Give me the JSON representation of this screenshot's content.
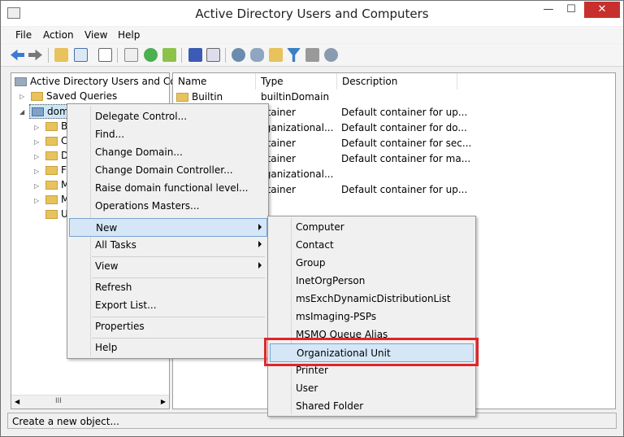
{
  "window": {
    "title": "Active Directory Users and Computers",
    "minimize": "—",
    "maximize": "☐",
    "close": "✕"
  },
  "menubar": [
    "File",
    "Action",
    "View",
    "Help"
  ],
  "toolbar": [
    "back-icon",
    "forward-icon",
    "up-folder-icon",
    "show-tree-icon",
    "properties-icon",
    "copy-icon",
    "refresh-icon",
    "export-icon",
    "help-icon",
    "console-icon",
    "new-user-icon",
    "new-group-icon",
    "new-ou-icon",
    "filter-icon",
    "delegate-icon"
  ],
  "tree": {
    "root": "Active Directory Users and Com",
    "saved_queries": "Saved Queries",
    "domain": "dom",
    "children": [
      "B",
      "C",
      "D",
      "F",
      "M",
      "M",
      "U"
    ]
  },
  "list": {
    "columns": [
      "Name",
      "Type",
      "Description"
    ],
    "rows": [
      {
        "name": "Builtin",
        "type": "builtinDomain",
        "desc": ""
      },
      {
        "name": "",
        "type": "ntainer",
        "desc": "Default container for up..."
      },
      {
        "name": "",
        "type": "rganizational...",
        "desc": "Default container for do..."
      },
      {
        "name": "",
        "type": "ntainer",
        "desc": "Default container for sec..."
      },
      {
        "name": "",
        "type": "ntainer",
        "desc": "Default container for ma..."
      },
      {
        "name": "",
        "type": "rganizational...",
        "desc": ""
      },
      {
        "name": "",
        "type": "ntainer",
        "desc": "Default container for up..."
      }
    ]
  },
  "context_menu": {
    "items": [
      "Delegate Control...",
      "Find...",
      "Change Domain...",
      "Change Domain Controller...",
      "Raise domain functional level...",
      "Operations Masters..."
    ],
    "new": "New",
    "all_tasks": "All Tasks",
    "view": "View",
    "refresh": "Refresh",
    "export": "Export List...",
    "properties": "Properties",
    "help": "Help"
  },
  "submenu": {
    "items": [
      "Computer",
      "Contact",
      "Group",
      "InetOrgPerson",
      "msExchDynamicDistributionList",
      "msImaging-PSPs",
      "MSMQ Queue Alias",
      "Organizational Unit",
      "Printer",
      "User",
      "Shared Folder"
    ]
  },
  "status": "Create a new object...",
  "hscroll": "III"
}
